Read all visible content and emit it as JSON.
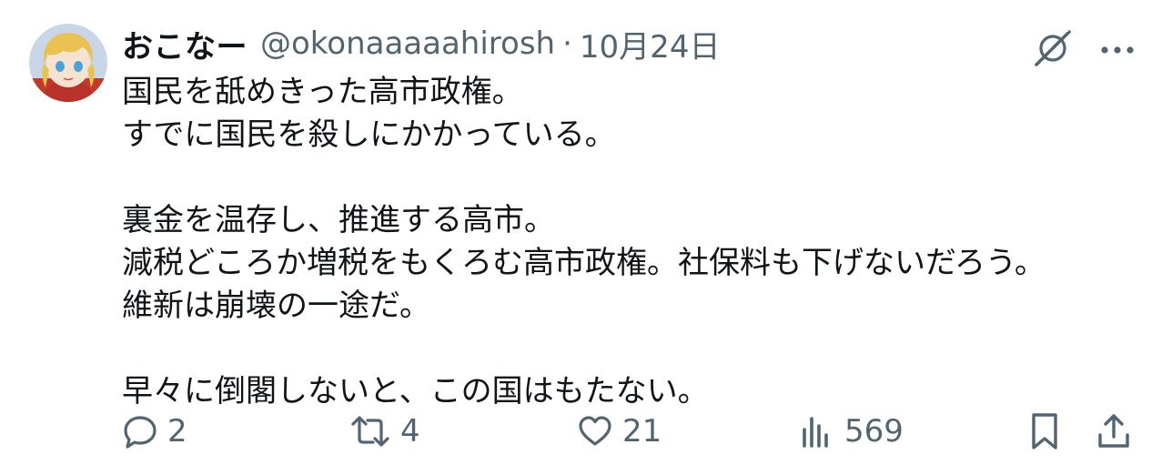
{
  "author": {
    "display_name": "おこなー",
    "handle": "@okonaaaaahirosh",
    "separator": "·",
    "date": "10月24日"
  },
  "header_icons": {
    "grok": "grok-icon",
    "more": "more-icon"
  },
  "tweet": {
    "paragraphs": [
      {
        "lines": [
          "国民を舐めきった高市政権。",
          "すでに国民を殺しにかかっている。"
        ]
      },
      {
        "lines": [
          "裏金を温存し、推進する高市。",
          "減税どころか増税をもくろむ高市政権。社保料も下げないだろう。",
          "維新は崩壊の一途だ。"
        ]
      },
      {
        "lines": [
          "早々に倒閣しないと、この国はもたない。"
        ]
      }
    ]
  },
  "metrics": {
    "replies": "2",
    "reposts": "4",
    "likes": "21",
    "views": "569"
  },
  "action_icons": [
    "reply-icon",
    "repost-icon",
    "like-icon",
    "views-icon",
    "bookmark-icon",
    "share-icon"
  ],
  "colors": {
    "text": "#0f1419",
    "secondary": "#536471",
    "background": "#ffffff"
  }
}
